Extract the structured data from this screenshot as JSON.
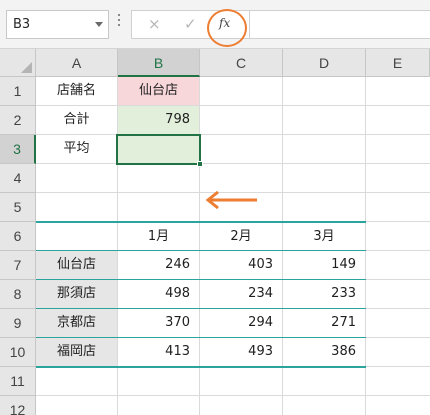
{
  "formula_bar": {
    "name_box_value": "B3",
    "cancel_icon": "×",
    "enter_icon": "✓",
    "fx_label": "fx",
    "formula_value": ""
  },
  "columns": [
    "A",
    "B",
    "C",
    "D",
    "E"
  ],
  "rows": [
    "1",
    "2",
    "3",
    "4",
    "5",
    "6",
    "7",
    "8",
    "9",
    "10",
    "11",
    "12"
  ],
  "selected": {
    "column": "B",
    "row": "3"
  },
  "cells": {
    "a1": "店舗名",
    "b1": "仙台店",
    "a2": "合計",
    "b2": "798",
    "a3": "平均",
    "b3": "",
    "b6": "1月",
    "c6": "2月",
    "d6": "3月",
    "a7": "仙台店",
    "b7": "246",
    "c7": "403",
    "d7": "149",
    "a8": "那須店",
    "b8": "498",
    "c8": "234",
    "d8": "233",
    "a9": "京都店",
    "b9": "370",
    "c9": "294",
    "d9": "271",
    "a10": "福岡店",
    "b10": "413",
    "c10": "493",
    "d10": "386"
  },
  "colors": {
    "accent_orange": "#ed7d31",
    "excel_green": "#217346",
    "table_teal": "#2aa49d",
    "pink_fill": "#f8d7da",
    "green_fill": "#e2efda",
    "gray_fill": "#e7e6e6"
  },
  "icons": {
    "name_box_dropdown": "chevron-down-icon",
    "callout": "arrow-left-icon"
  }
}
